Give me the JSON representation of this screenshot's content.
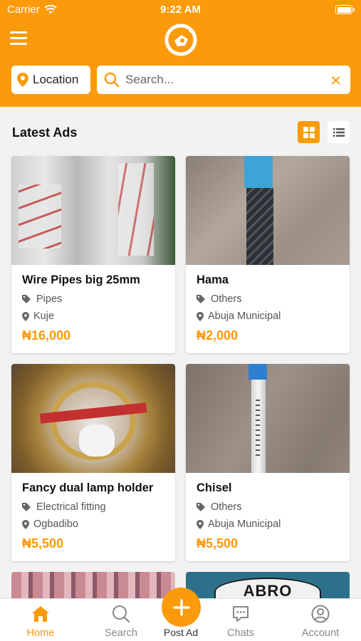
{
  "status_bar": {
    "carrier": "Carrier",
    "time": "9:22 AM"
  },
  "header": {
    "location_label": "Location",
    "search_placeholder": "Search...",
    "clear_symbol": "✕"
  },
  "section": {
    "title": "Latest Ads",
    "active_view": "grid"
  },
  "ads": [
    {
      "title": "Wire Pipes big 25mm",
      "category": "Pipes",
      "location": "Kuje",
      "price": "₦16,000"
    },
    {
      "title": "Hama",
      "category": "Others",
      "location": "Abuja Municipal",
      "price": "₦2,000"
    },
    {
      "title": "Fancy dual lamp holder",
      "category": "Electrical fitting",
      "location": "Ogbadibo",
      "price": "₦5,500"
    },
    {
      "title": "Chisel",
      "category": "Others",
      "location": "Abuja Municipal",
      "price": "₦5,500"
    }
  ],
  "partial_ads": [
    {
      "image_text": ""
    },
    {
      "image_text": "ABRO"
    }
  ],
  "tabbar": {
    "tabs": [
      {
        "label": "Home",
        "icon": "home-icon",
        "active": true
      },
      {
        "label": "Search",
        "icon": "search-icon",
        "active": false
      },
      {
        "label": "Chats",
        "icon": "chat-icon",
        "active": false
      },
      {
        "label": "Account",
        "icon": "account-icon",
        "active": false
      }
    ],
    "post_label": "Post Ad"
  },
  "colors": {
    "accent": "#fb9a0a",
    "background": "#f2f2f2"
  }
}
